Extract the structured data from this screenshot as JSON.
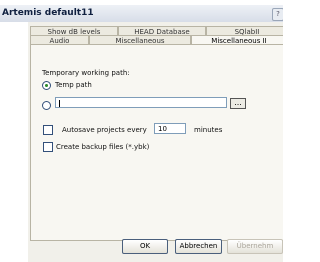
{
  "window": {
    "title": "Artemis  default11",
    "title_button": "?"
  },
  "tabs_row1": [
    {
      "label": "Show dB levels"
    },
    {
      "label": "HEAD Database"
    },
    {
      "label": "SQlabII"
    }
  ],
  "tabs_row2": [
    {
      "label": "Audio"
    },
    {
      "label": "Miscellaneous"
    },
    {
      "label": "Miscellaneous II"
    }
  ],
  "active_tab": "Miscellaneous II",
  "panel": {
    "working_path_heading": "Temporary working path:",
    "option_temp_path": {
      "label": "Temp path",
      "checked": true
    },
    "option_custom_path": {
      "checked": false,
      "value": ""
    },
    "browse_label": "...",
    "autosave": {
      "label": "Autosave projects every",
      "value": "10",
      "unit": "minutes",
      "checked": false
    },
    "backup": {
      "label": "Create backup files (*.ybk)",
      "checked": false
    }
  },
  "buttons": {
    "ok": "OK",
    "cancel": "Abbrechen",
    "apply": "Übernehm"
  }
}
